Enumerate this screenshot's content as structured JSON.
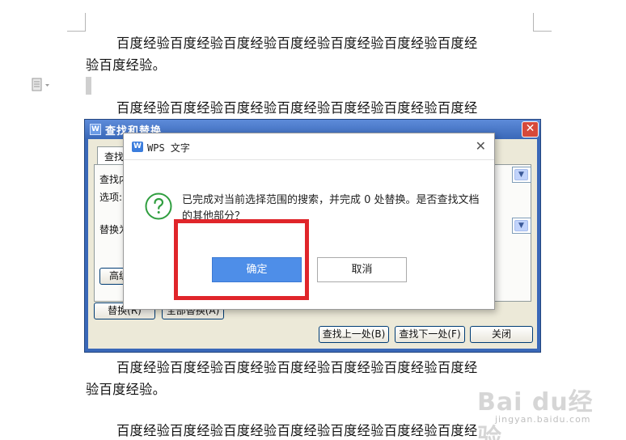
{
  "document": {
    "paragraph_1_line_1": "百度经验百度经验百度经验百度经验百度经验百度经验百度经",
    "paragraph_1_line_2": "验百度经验。",
    "paragraph_2_line_1": "百度经验百度经验百度经验百度经验百度经验百度经验百度经",
    "paragraph_3_line_1": "百度经验百度经验百度经验百度经验百度经验百度经验百度经",
    "paragraph_3_line_2": "验百度经验。",
    "paragraph_4_line_1": "百度经验百度经验百度经验百度经验百度经验百度经验百度经"
  },
  "find_replace_dialog": {
    "title": "查找和替换",
    "title_icon": "W",
    "close_glyph": "✕",
    "tab_find": "查找",
    "label_find": "查找内",
    "label_options": "选项:",
    "label_replace": "替换为",
    "advanced_button": "高级",
    "replace_button": "替换(R)",
    "replace_all_button": "全部替换(A)",
    "find_prev_button": "查找上一处(B)",
    "find_next_button": "查找下一处(F)",
    "close_button": "关闭",
    "dropdown_arrow": "▼"
  },
  "message_box": {
    "app_logo": "W",
    "title": "WPS 文字",
    "close_glyph": "✕",
    "icon": "question-icon",
    "message": "已完成对当前选择范围的搜索，并完成 0 处替换。是否查找文档的其他部分？",
    "ok_button": "确定",
    "cancel_button": "取消"
  },
  "annotation": {
    "highlight_color": "#e0252a"
  },
  "watermark": {
    "main": "Bai du经验",
    "sub": "jingyan.baidu.com"
  },
  "colors": {
    "ok_button": "#4e8ee8",
    "dialog_title_bar": "#3a68b8",
    "question_icon": "#2f9e3f"
  }
}
